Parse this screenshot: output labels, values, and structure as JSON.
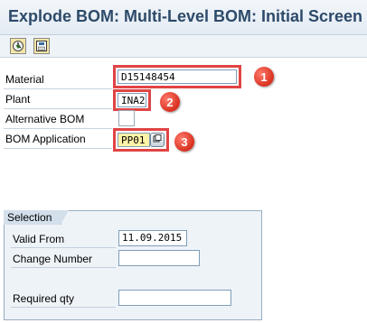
{
  "window": {
    "title": "Explode BOM: Multi-Level BOM: Initial Screen"
  },
  "toolbar": {
    "buttons": [
      {
        "icon": "execute-icon"
      },
      {
        "icon": "save-variant-icon"
      }
    ]
  },
  "form": {
    "material": {
      "label": "Material",
      "value": "D15148454"
    },
    "plant": {
      "label": "Plant",
      "value": "INA2"
    },
    "alternative_bom": {
      "label": "Alternative BOM",
      "value": ""
    },
    "bom_application": {
      "label": "BOM Application",
      "value": "PP01"
    }
  },
  "selection": {
    "title": "Selection",
    "valid_from": {
      "label": "Valid From",
      "value": "11.09.2015"
    },
    "change_number": {
      "label": "Change Number",
      "value": ""
    },
    "required_qty": {
      "label": "Required qty",
      "value": ""
    }
  },
  "annotations": {
    "badges": [
      "1",
      "2",
      "3"
    ],
    "highlight_color": "#e04444"
  }
}
